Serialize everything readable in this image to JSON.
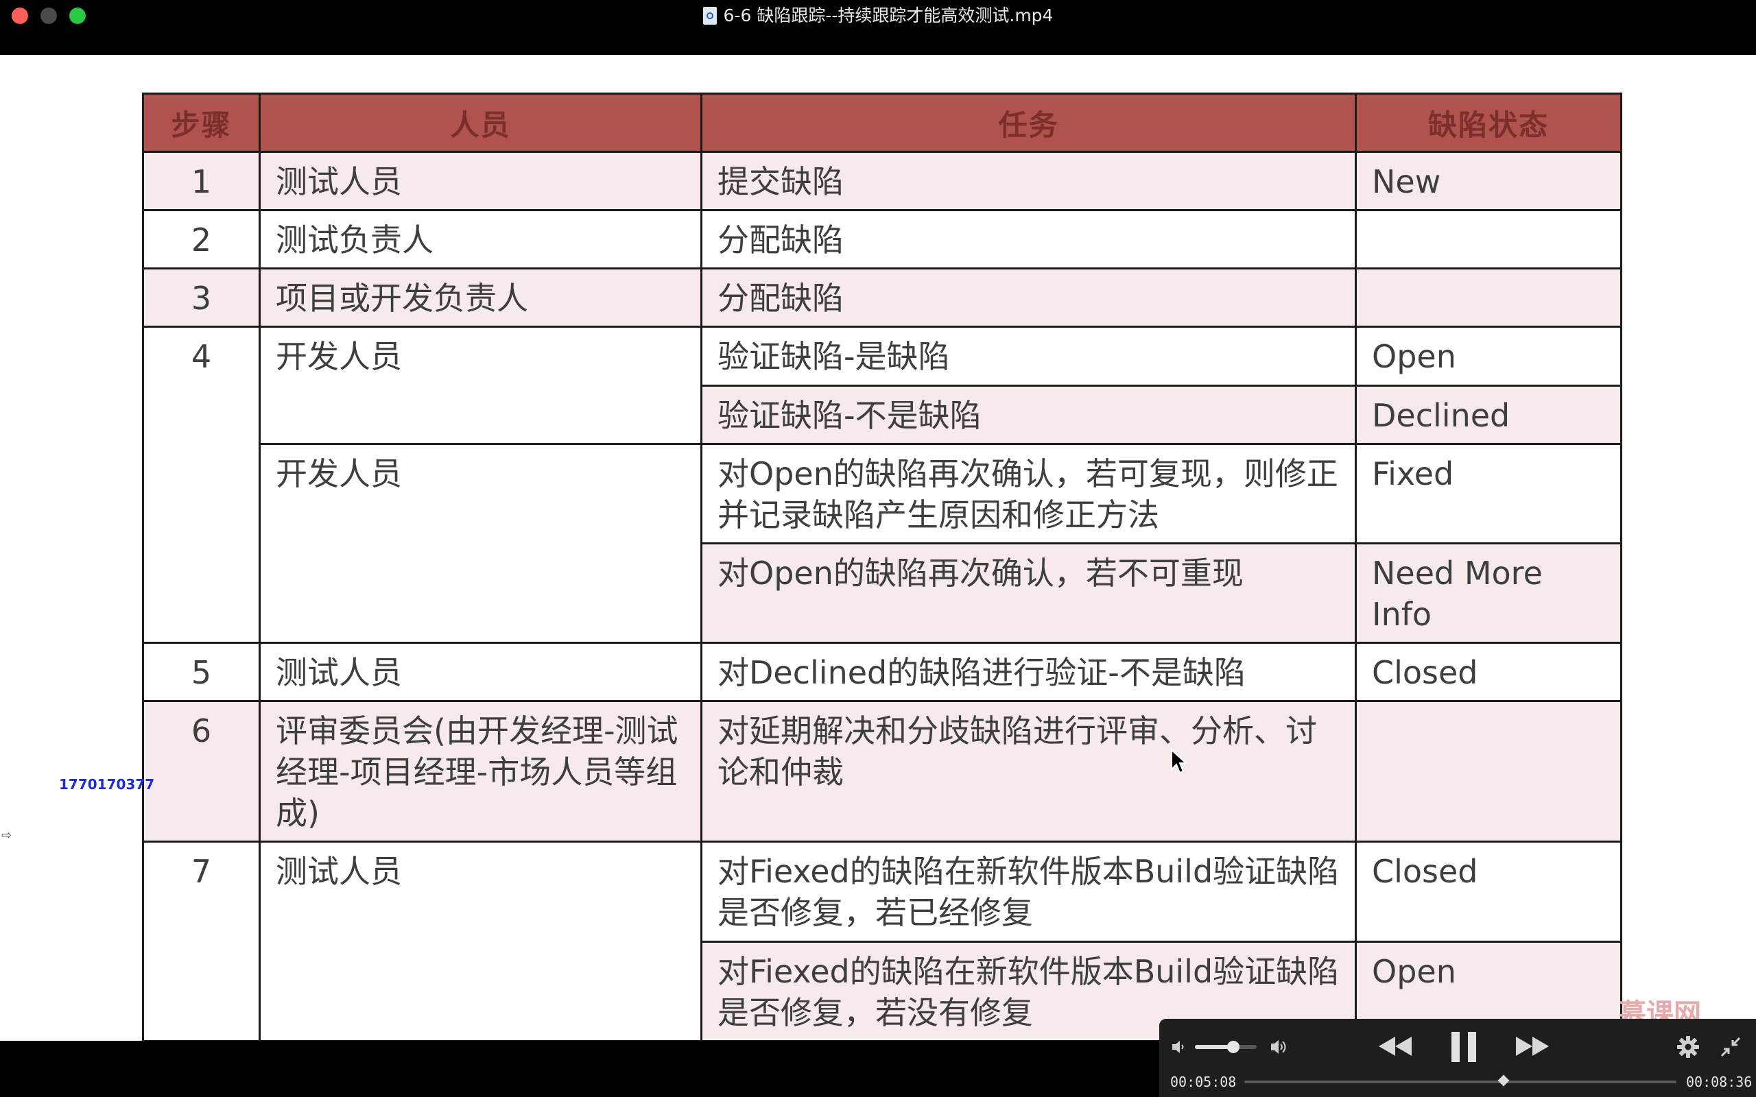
{
  "window": {
    "title": "6-6 缺陷跟踪--持续跟踪才能高效测试.mp4"
  },
  "table": {
    "headers": [
      "步骤",
      "人员",
      "任务",
      "缺陷状态"
    ],
    "rows": {
      "r1": {
        "step": "1",
        "person": "测试人员",
        "task": "提交缺陷",
        "status": "New"
      },
      "r2": {
        "step": "2",
        "person": "测试负责人",
        "task": "分配缺陷",
        "status": ""
      },
      "r3": {
        "step": "3",
        "person": "项目或开发负责人",
        "task": "分配缺陷",
        "status": ""
      },
      "r4a": {
        "step": "4",
        "person": "开发人员",
        "task": "验证缺陷-是缺陷",
        "status": "Open"
      },
      "r4b": {
        "task": "验证缺陷-不是缺陷",
        "status": "Declined"
      },
      "r4c": {
        "person": "开发人员",
        "task": "对Open的缺陷再次确认，若可复现，则修正并记录缺陷产生原因和修正方法",
        "status": "Fixed"
      },
      "r4d": {
        "task": "对Open的缺陷再次确认，若不可重现",
        "status": "Need More Info"
      },
      "r5": {
        "step": "5",
        "person": "测试人员",
        "task": "对Declined的缺陷进行验证-不是缺陷",
        "status": "Closed"
      },
      "r6": {
        "step": "6",
        "person": "评审委员会(由开发经理-测试经理-项目经理-市场人员等组成)",
        "task": "对延期解决和分歧缺陷进行评审、分析、讨论和仲裁",
        "status": ""
      },
      "r7a": {
        "step": "7",
        "person": "测试人员",
        "task": "对Fiexed的缺陷在新软件版本Build验证缺陷是否修复，若已经修复",
        "status": "Closed"
      },
      "r7b": {
        "task": "对Fiexed的缺陷在新软件版本Build验证缺陷是否修复，若没有修复",
        "status": "Open"
      }
    }
  },
  "overlay": {
    "user_id": "1770170377",
    "watermark": "慕课网"
  },
  "player": {
    "current_time": "00:05:08",
    "total_time": "00:08:36",
    "progress_fraction": 0.6,
    "volume_fraction": 0.62
  },
  "icons": {
    "volume_low": "speaker-low-icon",
    "volume_high": "speaker-high-icon",
    "rewind": "rewind-icon",
    "pause": "pause-icon",
    "forward": "fast-forward-icon",
    "settings": "gear-icon",
    "exit_fullscreen": "collapse-icon"
  }
}
